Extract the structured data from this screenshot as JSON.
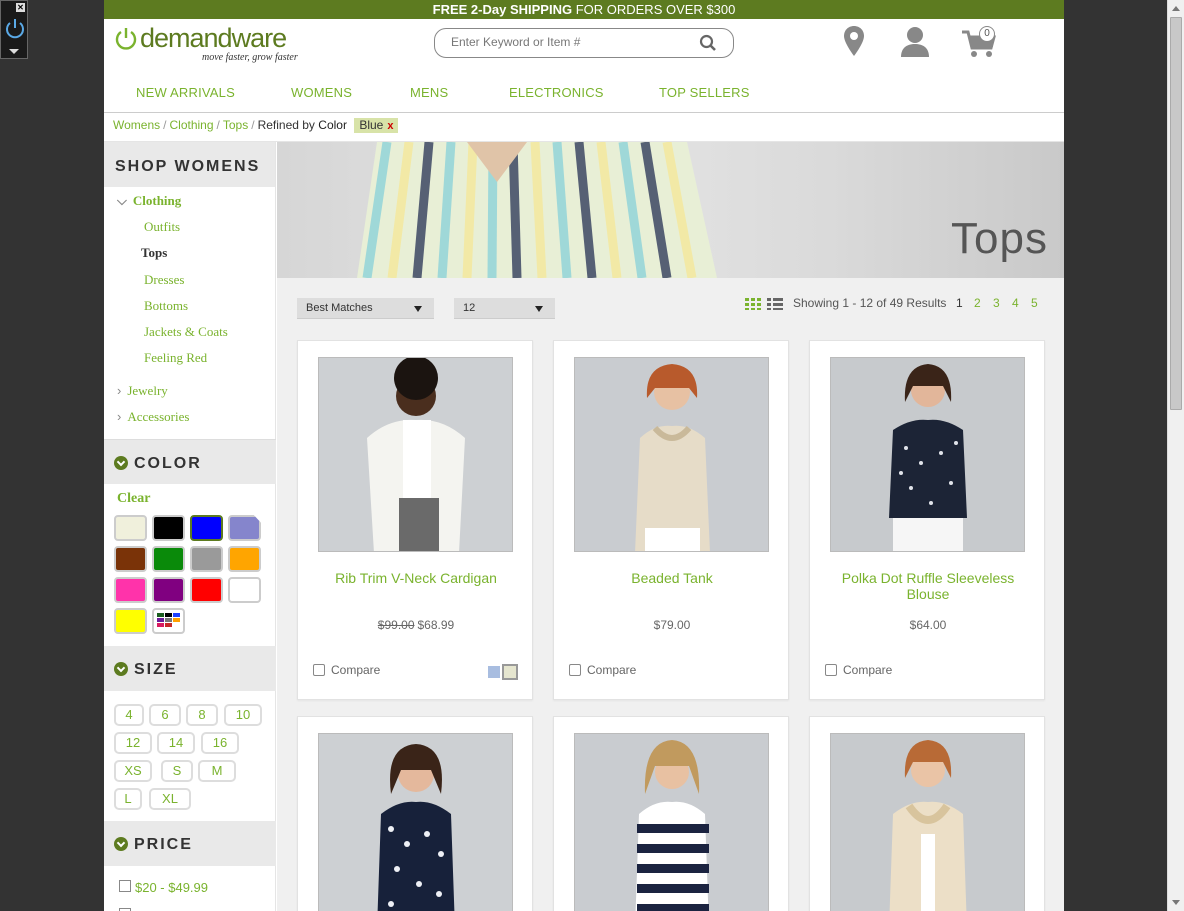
{
  "promo": {
    "bold_text": "FREE 2-Day SHIPPING",
    "rest_text": " FOR ORDERS OVER $300"
  },
  "logo": {
    "word": "demandware",
    "tagline": "move faster, grow faster"
  },
  "search": {
    "placeholder": "Enter Keyword or Item #"
  },
  "cart": {
    "count": "0"
  },
  "nav": [
    "NEW ARRIVALS",
    "WOMENS",
    "MENS",
    "ELECTRONICS",
    "TOP SELLERS"
  ],
  "breadcrumb": {
    "items": [
      "Womens",
      "Clothing",
      "Tops"
    ],
    "refined_prefix": "Refined by",
    "refined_attr": "Color",
    "refined_value": "Blue",
    "remove": "x"
  },
  "sidebar": {
    "heading": "SHOP WOMENS",
    "categories": {
      "clothing": "Clothing",
      "sub": [
        "Outfits",
        "Tops",
        "Dresses",
        "Bottoms",
        "Jackets & Coats",
        "Feeling Red"
      ],
      "jewelry": "Jewelry",
      "accessories": "Accessories"
    },
    "color_heading": "COLOR",
    "clear": "Clear",
    "colors": [
      "#f0f0dc",
      "#000000",
      "#0000ff",
      "#8585cc",
      "#7a3308",
      "#0a8a0a",
      "#9a9a9a",
      "#ffa500",
      "#ff33aa",
      "#800080",
      "#ff0000",
      "#ffffff",
      "#ffff00",
      "multi"
    ],
    "selected_color": "#0000ff",
    "size_heading": "SIZE",
    "sizes": [
      "4",
      "6",
      "8",
      "10",
      "12",
      "14",
      "16",
      "XS",
      "S",
      "M",
      "L",
      "XL"
    ],
    "price_heading": "PRICE",
    "price_option": "$20 - $49.99"
  },
  "banner": {
    "title": "Tops"
  },
  "toolbar": {
    "sort": "Best Matches",
    "per_page": "12",
    "showing": "Showing 1 - 12 of 49 Results",
    "pages": [
      "1",
      "2",
      "3",
      "4",
      "5"
    ],
    "current_page": "1"
  },
  "products": [
    {
      "name": "Rib Trim V-Neck Cardigan",
      "old_price": "$99.00",
      "price": "$68.99",
      "compare": "Compare"
    },
    {
      "name": "Beaded Tank",
      "old_price": "",
      "price": "$79.00",
      "compare": "Compare"
    },
    {
      "name": "Polka Dot Ruffle Sleeveless Blouse",
      "old_price": "",
      "price": "$64.00",
      "compare": "Compare"
    },
    {
      "name": "",
      "old_price": "",
      "price": "",
      "compare": ""
    },
    {
      "name": "",
      "old_price": "",
      "price": "",
      "compare": ""
    },
    {
      "name": "",
      "old_price": "",
      "price": "",
      "compare": ""
    }
  ],
  "brand_colors": {
    "green_dark": "#5d7b20",
    "green_link": "#7ab32e"
  }
}
